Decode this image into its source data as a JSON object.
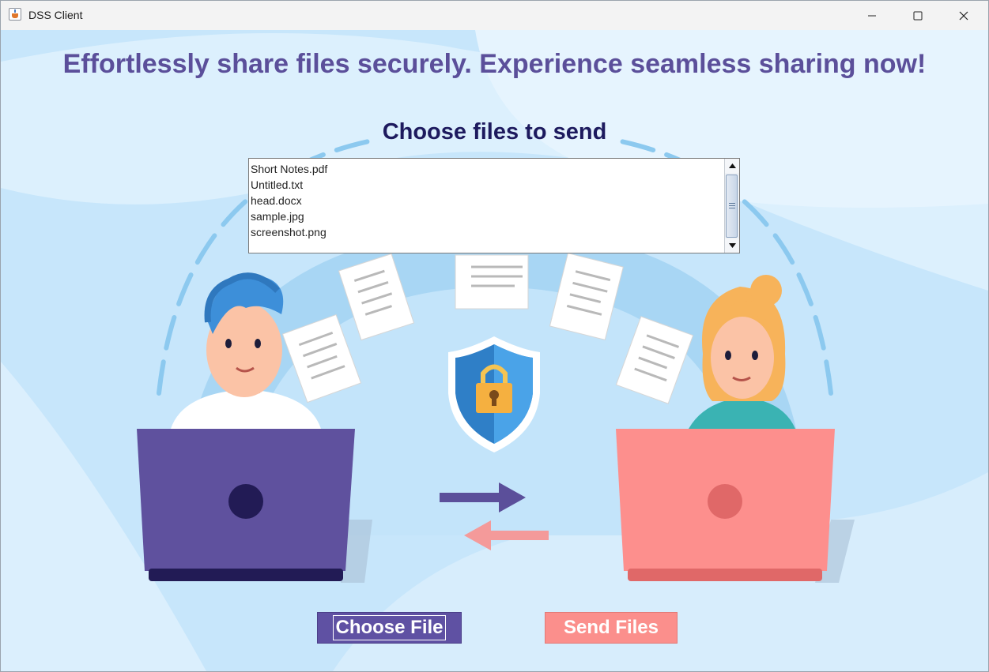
{
  "window": {
    "title": "DSS Client",
    "controls": [
      "minimize-icon",
      "maximize-icon",
      "close-icon"
    ]
  },
  "headline": "Effortlessly share files securely. Experience seamless sharing now!",
  "subheading": "Choose files to send",
  "file_list": {
    "items": [
      "Short Notes.pdf",
      "Untitled.txt",
      "head.docx",
      "sample.jpg",
      "screenshot.png"
    ]
  },
  "buttons": {
    "choose_file": "Choose File",
    "send_files": "Send Files"
  },
  "colors": {
    "headline": "#5b4f9a",
    "subheading": "#1d1a5e",
    "choose_button": "#5f51a3",
    "send_button": "#fb8f8c",
    "background": "#c7e6fb"
  },
  "illustration": {
    "icons": [
      "person-male-icon",
      "person-female-icon",
      "laptop-purple-icon",
      "laptop-pink-icon",
      "shield-lock-icon",
      "document-icon",
      "arrow-right-icon",
      "arrow-left-icon"
    ]
  }
}
